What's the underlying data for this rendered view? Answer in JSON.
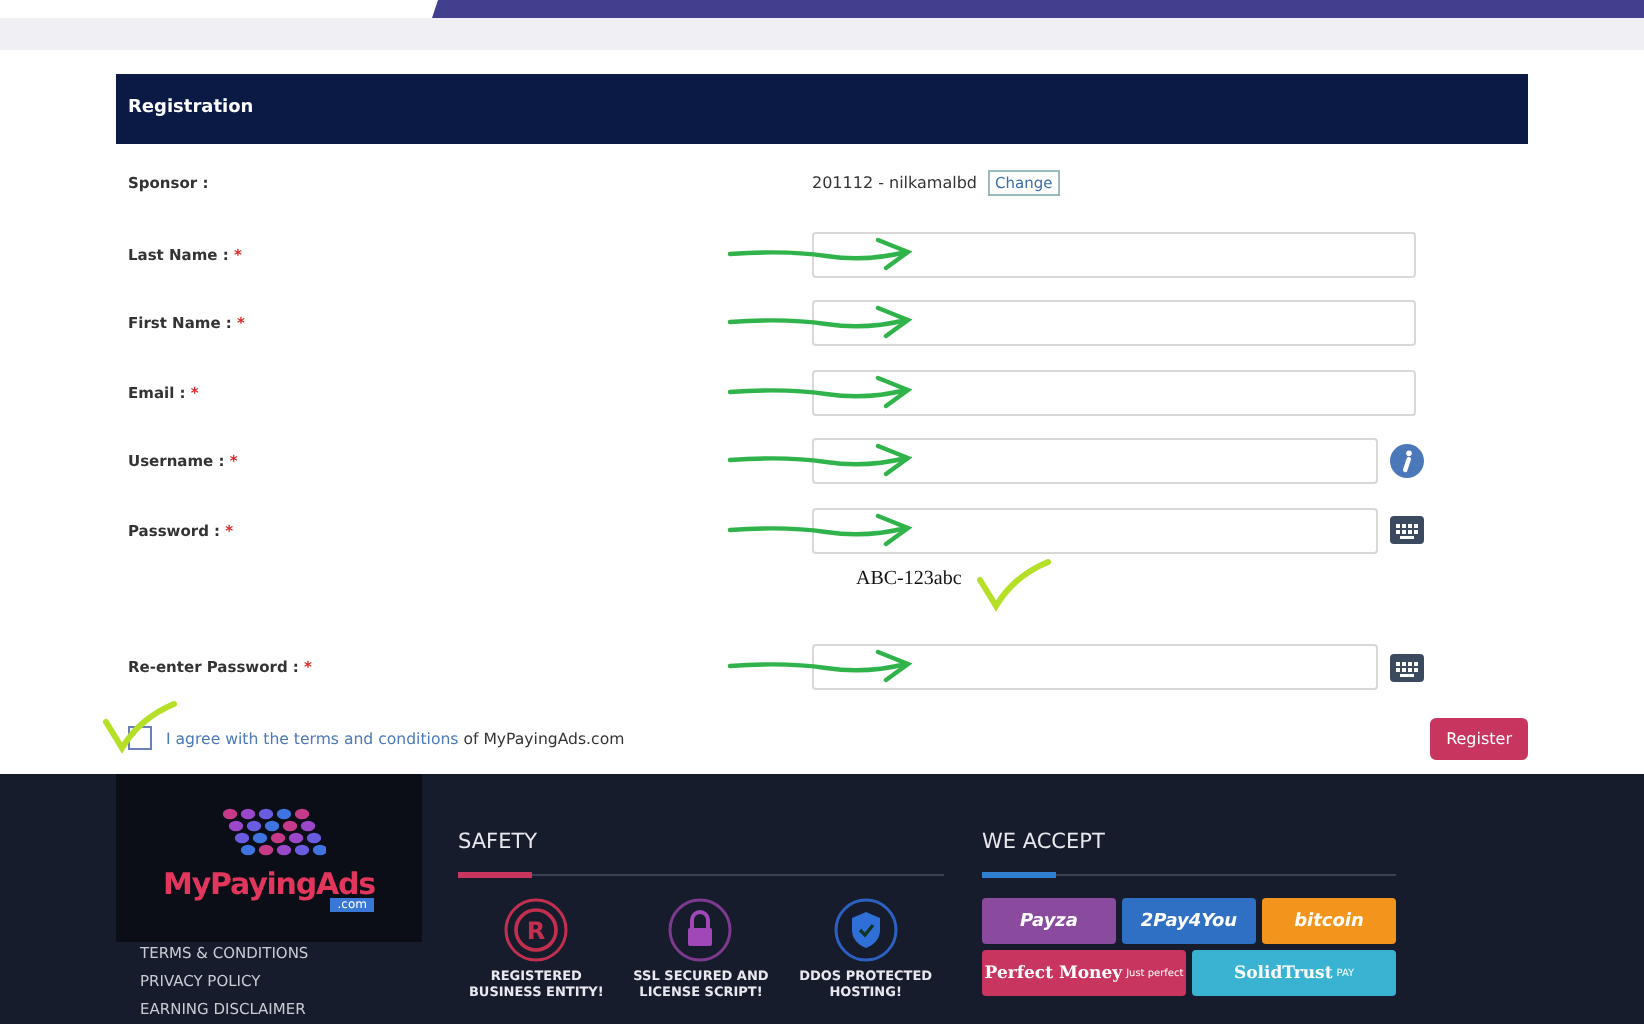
{
  "form": {
    "title": "Registration",
    "sponsor": {
      "label": "Sponsor :",
      "value": "201112 - nilkamalbd",
      "action": "Change"
    },
    "fields": [
      {
        "label": "Last Name :",
        "required_mark": "*",
        "kind": "text",
        "arrow_drawn": true
      },
      {
        "label": "First Name :",
        "required_mark": "*",
        "kind": "text",
        "arrow_drawn": true
      },
      {
        "label": "Email :",
        "required_mark": "*",
        "kind": "text",
        "arrow_drawn": true
      },
      {
        "label": "Username :",
        "required_mark": "*",
        "kind": "info",
        "arrow_drawn": true
      },
      {
        "label": "Password :",
        "required_mark": "*",
        "kind": "keyboard",
        "arrow_drawn": true,
        "note": "ABC-123abc",
        "note_ticked": true
      },
      {
        "label": "Re-enter Password :",
        "required_mark": "*",
        "kind": "keyboard",
        "arrow_drawn": true
      }
    ],
    "terms": {
      "checked": false,
      "ticked": true,
      "link": "I agree with the terms and conditions",
      "text": "of MyPayingAds.com"
    },
    "submit": "Register"
  },
  "footer": {
    "logo": {
      "name": "MyPayingAds",
      "suffix": ".com"
    },
    "links": [
      "TERMS & CONDITIONS",
      "PRIVACY POLICY",
      "EARNING DISCLAIMER"
    ],
    "safety": {
      "title": "SAFETY",
      "badges": [
        {
          "kind": "registered",
          "symbol": "R",
          "label": "REGISTERED BUSINESS ENTITY!"
        },
        {
          "kind": "lock",
          "label": "SSL SECURED AND LICENSE SCRIPT!"
        },
        {
          "kind": "shield",
          "label": "DDOS PROTECTED HOSTING!"
        }
      ]
    },
    "accept": {
      "title": "WE ACCEPT",
      "methods": [
        {
          "name": "Payza",
          "color": "#8a4a9e"
        },
        {
          "name": "2Pay4You",
          "color": "#2f6fc4"
        },
        {
          "name": "bitcoin",
          "color": "#f3951c"
        },
        {
          "name": "Perfect Money",
          "sub": "Just perfect",
          "color": "#c8365f"
        },
        {
          "name": "SolidTrust",
          "sub": "PAY",
          "color": "#3ab3d3"
        }
      ]
    }
  }
}
